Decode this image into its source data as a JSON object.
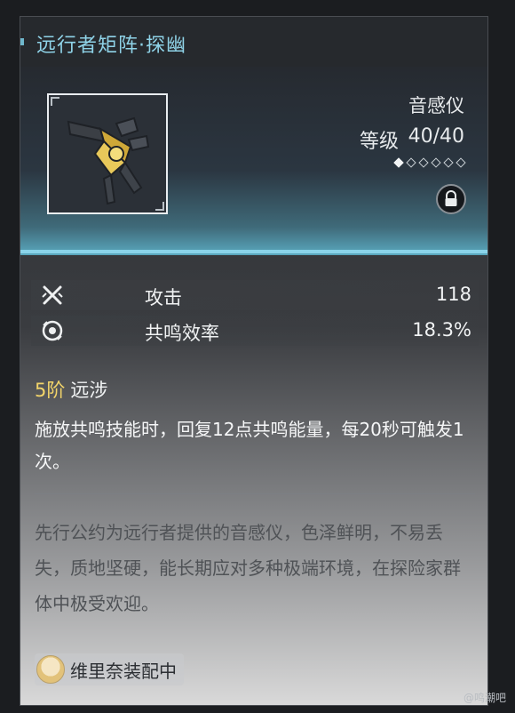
{
  "item": {
    "name": "远行者矩阵·探幽",
    "type": "音感仪",
    "level_label": "等级",
    "level_value": "40/40",
    "rank_stars": 6,
    "rank_filled": 1,
    "locked": true
  },
  "stats": [
    {
      "name": "攻击",
      "value": "118",
      "icon": "attack-icon"
    },
    {
      "name": "共鸣效率",
      "value": "18.3%",
      "icon": "energy-regen-icon"
    }
  ],
  "passive": {
    "rank": "5阶",
    "name": "远涉",
    "description": "施放共鸣技能时，回复12点共鸣能量，每20秒可触发1次。"
  },
  "lore": "先行公约为远行者提供的音感仪，色泽鲜明，不易丢失，质地坚硬，能长期应对多种极端环境，在探险家群体中极受欢迎。",
  "equipped": {
    "label": "维里奈装配中"
  },
  "watermark": "@鸣潮吧",
  "colors": {
    "title": "#8fd3e8",
    "rank_accent": "#f2d46a",
    "accent_line": "#8ad4ea"
  }
}
